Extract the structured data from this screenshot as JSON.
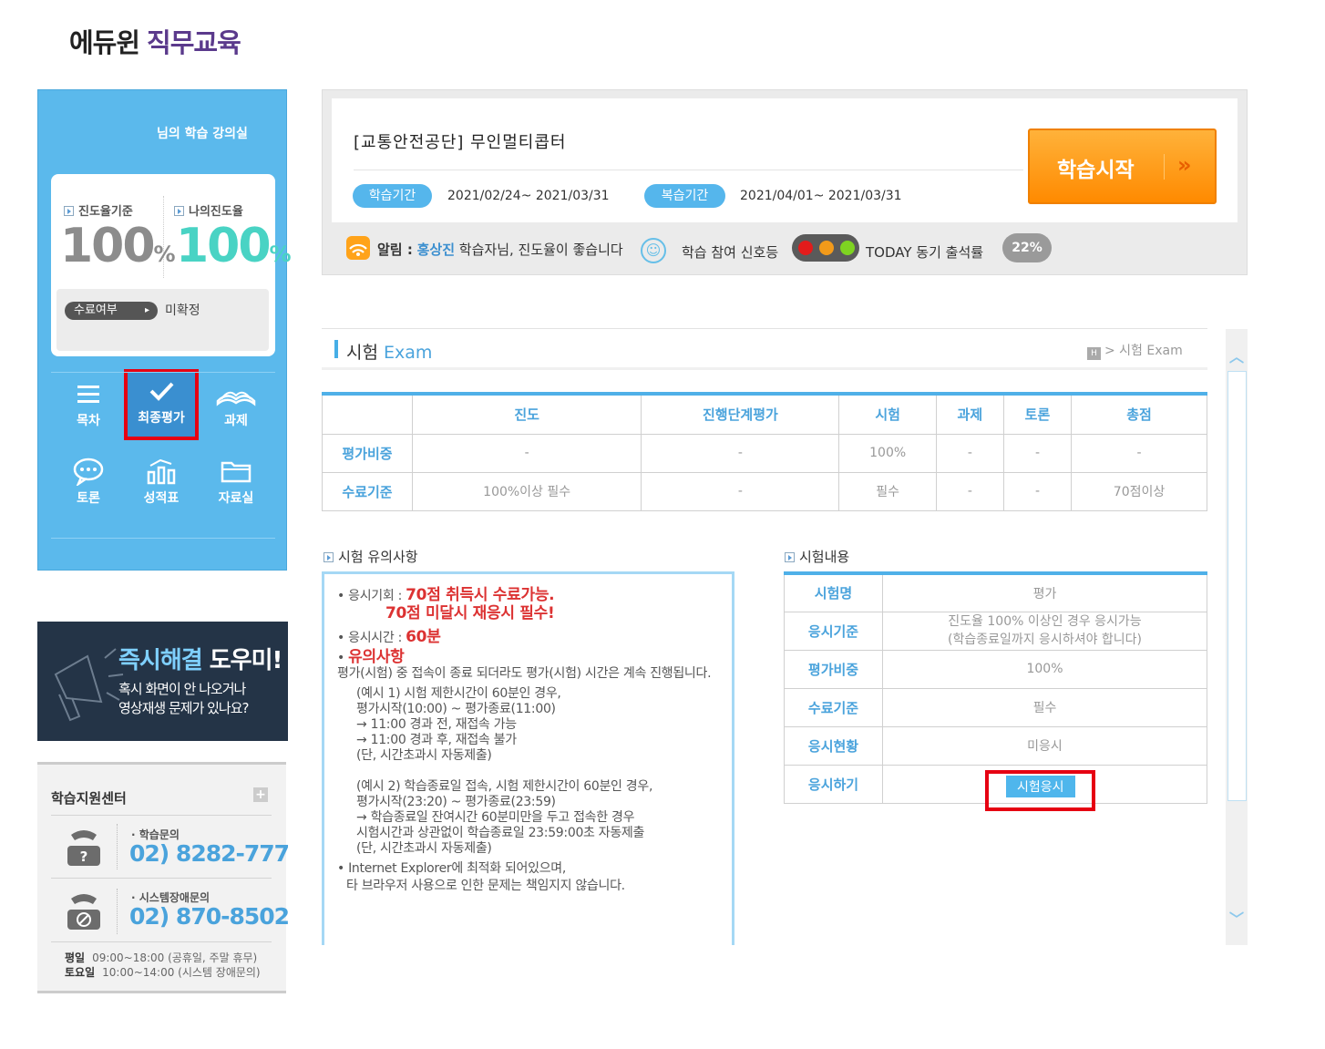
{
  "logo": {
    "part1": "에듀윈",
    "part2": "직무교육"
  },
  "sidebar": {
    "greeting": "님의 학습 강의실",
    "progress_standard_label": "진도율기준",
    "progress_standard_value": "100",
    "my_progress_label": "나의진도율",
    "my_progress_value": "100",
    "percent_unit": "%",
    "completion_label": "수료여부",
    "completion_value": "미확정",
    "nav": [
      {
        "label": "목차",
        "icon": "list-icon"
      },
      {
        "label": "최종평가",
        "icon": "check-icon"
      },
      {
        "label": "과제",
        "icon": "book-icon"
      },
      {
        "label": "토론",
        "icon": "chat-icon"
      },
      {
        "label": "성적표",
        "icon": "bar-chart-icon"
      },
      {
        "label": "자료실",
        "icon": "folder-icon"
      }
    ]
  },
  "banner": {
    "title_colored": "즉시해결",
    "title_white": " 도우미!",
    "line1": "혹시 화면이 안 나오거나",
    "line2": "영상재생 문제가 있나요?"
  },
  "support": {
    "title": "학습지원센터",
    "plus": "+",
    "inquiry_label": "학습문의",
    "inquiry_number": "02) 8282-777",
    "system_label": "시스템장애문의",
    "system_number": "02) 870-8502",
    "weekday_label": "평일",
    "weekday_hours": "09:00~18:00 (공휴일, 주말 휴무)",
    "saturday_label": "토요일",
    "saturday_hours": "10:00~14:00 (시스템 장애문의)"
  },
  "course": {
    "title": "[교통안전공단] 무인멀티콥터",
    "study_period_label": "학습기간",
    "study_period": "2021/02/24~ 2021/03/31",
    "review_period_label": "복습기간",
    "review_period": "2021/04/01~ 2021/03/31",
    "start_button": "학습시작",
    "start_arrow": "»",
    "notice_label": "알림 :",
    "notice_name": "홍상진",
    "notice_text": "학습자님, 진도율이 좋습니다",
    "signal_label": "학습 참여 신호등",
    "today_label": "TODAY 동기 출석률",
    "today_value": "22%"
  },
  "exam": {
    "title_ko": "시험",
    "title_en": "Exam",
    "breadcrumb": "> 시험 Exam",
    "eval_table": {
      "headers": [
        "",
        "진도",
        "진행단계평가",
        "시험",
        "과제",
        "토론",
        "총점"
      ],
      "rows": [
        [
          "평가비중",
          "-",
          "-",
          "100%",
          "-",
          "-",
          "-"
        ],
        [
          "수료기준",
          "100%이상 필수",
          "-",
          "필수",
          "-",
          "-",
          "70점이상"
        ]
      ]
    },
    "notes_title": "시험 유의사항",
    "notes": {
      "chance_label": "• 응시기회 :",
      "chance_red1": "70점 취득시 수료가능.",
      "chance_red2": "70점 미달시 재응시 필수!",
      "time_label": "• 응시시간 :",
      "time_red": "60분",
      "caution_bullet": "•",
      "caution_red": "유의사항",
      "caution_text": "평가(시험) 중 접속이 종료 되더라도 평가(시험) 시간은 계속 진행됩니다.",
      "ex1": [
        "(예시 1) 시험 제한시간이 60분인 경우,",
        "평가시작(10:00) ~ 평가종료(11:00)",
        "→ 11:00 경과 전, 재접속 가능",
        "→ 11:00 경과 후, 재접속 불가",
        "(단, 시간초과시 자동제출)"
      ],
      "ex2": [
        "(예시 2) 학습종료일 접속, 시험 제한시간이 60분인 경우,",
        "평가시작(23:20) ~ 평가종료(23:59)",
        "→ 학습종료일 잔여시간 60분미만을 두고 접속한 경우",
        "시험시간과 상관없이 학습종료일 23:59:00초 자동제출",
        "(단, 시간초과시 자동제출)"
      ],
      "ie_line1": "• Internet Explorer에 최적화 되어있으며,",
      "ie_line2": "타 브라우저 사용으로 인한 문제는 책임지지 않습니다."
    },
    "info_title": "시험내용",
    "info_rows": [
      {
        "label": "시험명",
        "value": "평가"
      },
      {
        "label": "응시기준",
        "value": "진도율 100% 이상인 경우 응시가능",
        "value2": "(학습종료일까지 응시하셔야 합니다)"
      },
      {
        "label": "평가비중",
        "value": "100%"
      },
      {
        "label": "수료기준",
        "value": "필수"
      },
      {
        "label": "응시현황",
        "value": "미응시"
      },
      {
        "label": "응시하기",
        "button": "시험응시"
      }
    ]
  },
  "colors": {
    "accent": "#4aa3dc",
    "sidebar": "#5bb9ec",
    "highlight": "#e60012",
    "start": "#ff8a00"
  }
}
